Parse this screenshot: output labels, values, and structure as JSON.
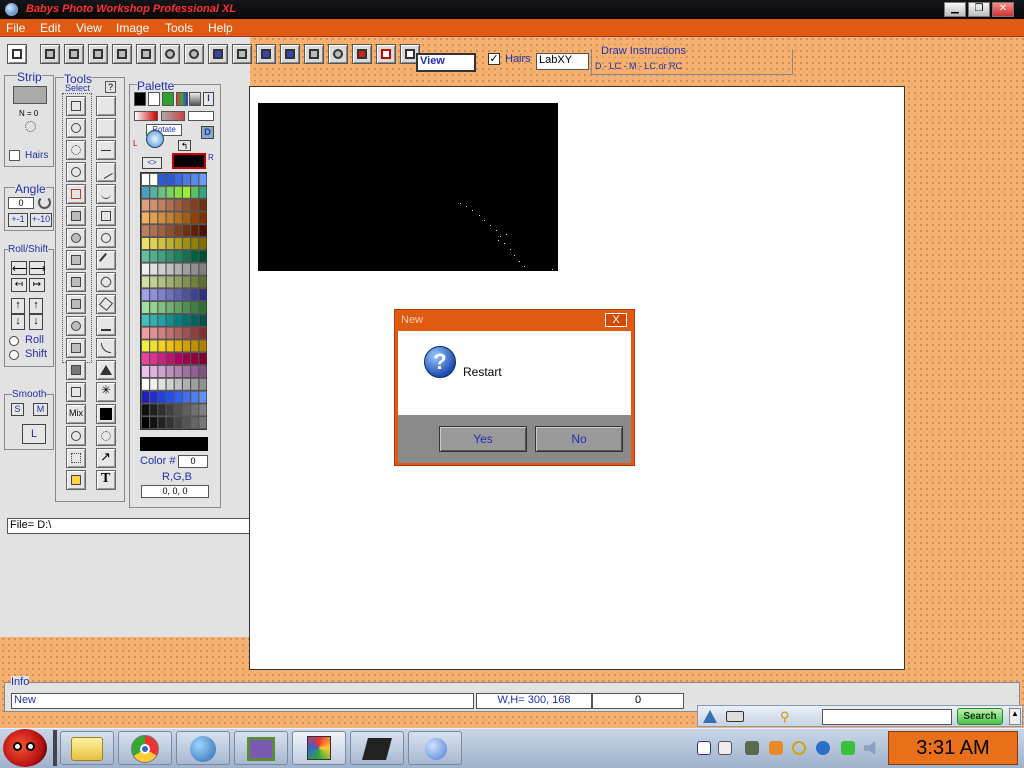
{
  "window": {
    "title": "Babys Photo Workshop Professional XL"
  },
  "menu": [
    "File",
    "Edit",
    "View",
    "Image",
    "Tools",
    "Help"
  ],
  "toolbar": {
    "view_field": "View",
    "hairs_label": "Hairs",
    "hairs_checked": true,
    "color_space": "LabXY",
    "draw_instructions_title": "Draw Instructions",
    "draw_instructions_text": "D - LC - M - LC or RC"
  },
  "strip": {
    "title": "Strip",
    "n_label": "N = 0",
    "hairs_label": "Hairs"
  },
  "angle": {
    "title": "Angle",
    "value": "0",
    "minus": "+-1",
    "plus": "+-10"
  },
  "roll_shift": {
    "title": "Roll/Shift",
    "roll": "Roll",
    "shift": "Shift"
  },
  "smooth": {
    "title": "Smooth",
    "s": "S",
    "m": "M",
    "l": "L"
  },
  "tools": {
    "title": "Tools",
    "select": "Select",
    "help": "?"
  },
  "palette": {
    "title": "Palette",
    "rotate": "Rotate",
    "l": "L",
    "r": "R",
    "d": "D",
    "i": "I",
    "color_label": "Color #",
    "color_value": "0",
    "rgb_label": "R,G,B",
    "rgb_value": "0, 0, 0"
  },
  "file": {
    "label": "File= D:\\"
  },
  "dialog": {
    "title": "New",
    "message": "Restart",
    "yes": "Yes",
    "no": "No",
    "close": "X"
  },
  "info": {
    "title": "Info",
    "status": "New",
    "dimensions": "W,H= 300, 168",
    "value": "0"
  },
  "search": {
    "button": "Search",
    "placeholder": ""
  },
  "taskbar": {
    "clock": "3:31 AM"
  },
  "colors": {
    "accent": "#e05a12",
    "label_blue": "#2030b0",
    "clock_bg": "#e8701a"
  }
}
